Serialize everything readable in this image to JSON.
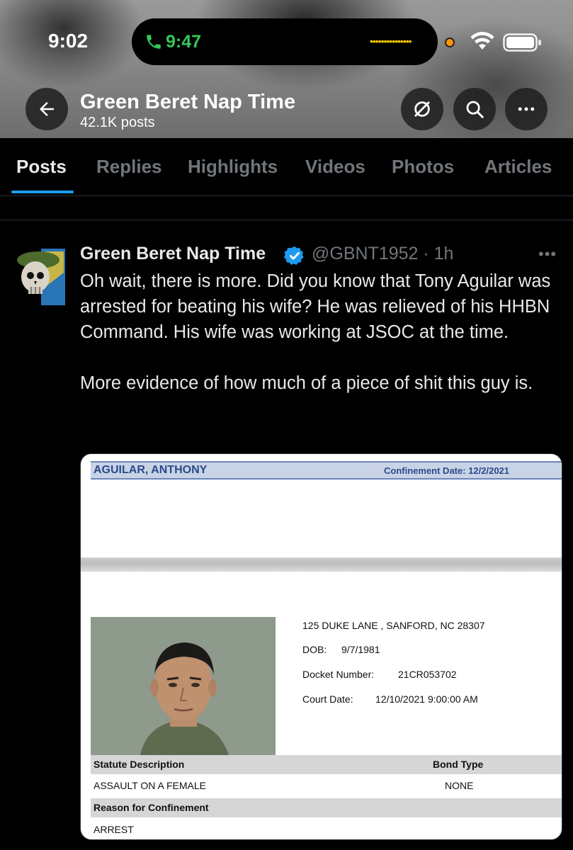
{
  "status_bar": {
    "time": "9:02",
    "call_time": "9:47"
  },
  "header": {
    "title": "Green Beret Nap Time",
    "posts_count": "42.1K posts"
  },
  "tabs": [
    {
      "label": "Posts",
      "active": true
    },
    {
      "label": "Replies"
    },
    {
      "label": "Highlights"
    },
    {
      "label": "Videos"
    },
    {
      "label": "Photos"
    },
    {
      "label": "Articles"
    }
  ],
  "post": {
    "author": "Green Beret Nap Time",
    "handle_time": "@GBNT1952 · 1h",
    "text": "Oh wait, there is more. Did you know that Tony Aguilar was arrested for beating his wife? He was relieved of his HHBN Command. His wife was working at JSOC at the time.\n\nMore evidence of how much of a piece of shit this guy is."
  },
  "record": {
    "name": "AGUILAR, ANTHONY",
    "confinement": "Confinement Date:  12/2/2021",
    "address": "125 DUKE LANE ,  SANFORD, NC 28307",
    "dob_label": "DOB:",
    "dob": "9/7/1981",
    "docket_label": "Docket Number:",
    "docket": "21CR053702",
    "court_label": "Court Date:",
    "court_date": "12/10/2021 9:00:00 AM",
    "statute_header": "Statute Description",
    "bond_header": "Bond Type",
    "statute": "ASSAULT ON A FEMALE",
    "bond": "NONE",
    "reason_header": "Reason for Confinement",
    "reason": "ARREST"
  },
  "colors": {
    "accent": "#1d9bf0",
    "call_green": "#34c759",
    "record_blue": "#2b4a8a"
  }
}
